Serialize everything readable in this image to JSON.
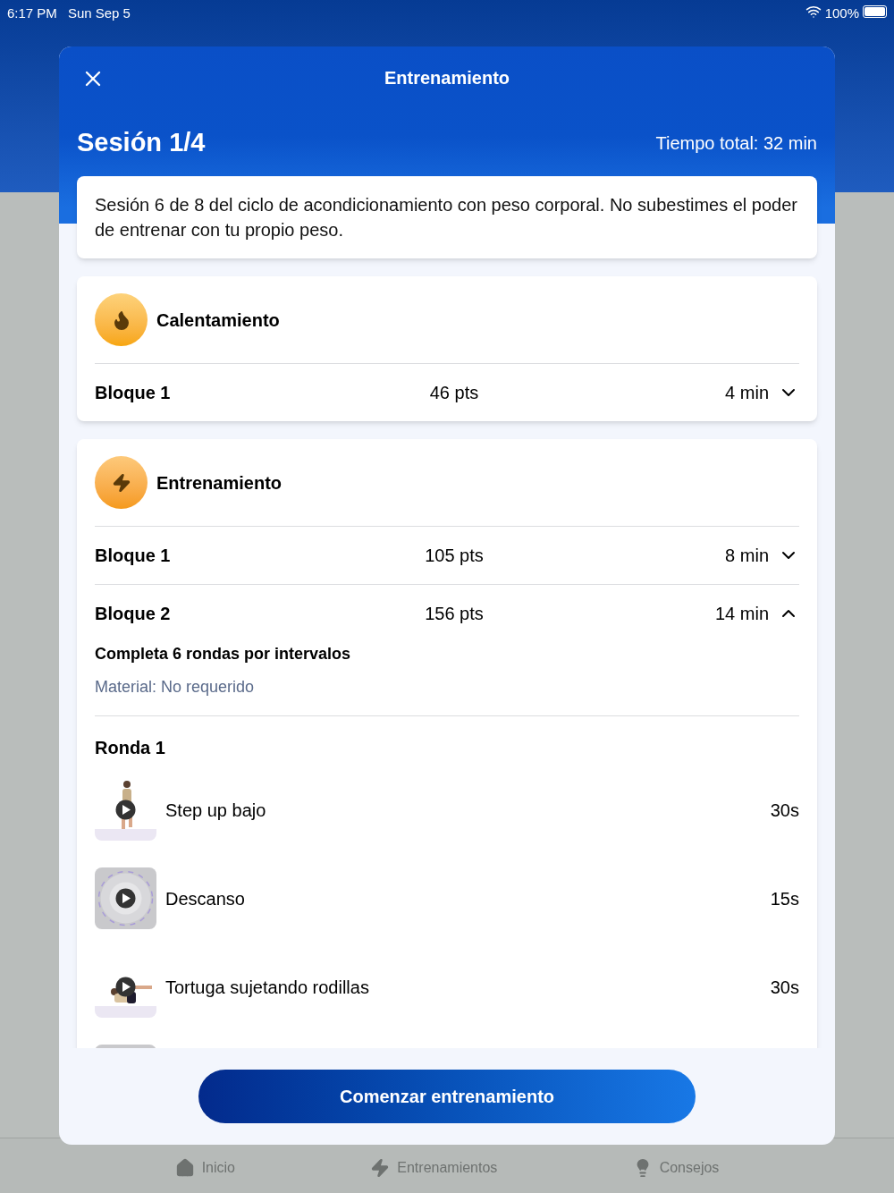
{
  "status_bar": {
    "time": "6:17 PM",
    "date": "Sun Sep 5",
    "battery": "100%"
  },
  "modal": {
    "title": "Entrenamiento",
    "session": "Sesión 1/4",
    "total_time": "Tiempo total: 32 min",
    "description": "Sesión 6 de 8 del ciclo de acondicionamiento con peso corporal. No subestimes el poder de entrenar con tu propio peso.",
    "sections": [
      {
        "title": "Calentamiento",
        "blocks": [
          {
            "name": "Bloque 1",
            "points": "46 pts",
            "duration": "4 min",
            "expanded": false
          }
        ]
      },
      {
        "title": "Entrenamiento",
        "blocks": [
          {
            "name": "Bloque 1",
            "points": "105 pts",
            "duration": "8 min",
            "expanded": false
          },
          {
            "name": "Bloque 2",
            "points": "156 pts",
            "duration": "14 min",
            "expanded": true,
            "instructions": "Completa 6 rondas por intervalos",
            "material": "Material: No requerido",
            "rounds": [
              {
                "title": "Ronda 1",
                "exercises": [
                  {
                    "kind": "exercise",
                    "name": "Step up bajo",
                    "duration": "30s"
                  },
                  {
                    "kind": "rest",
                    "name": "Descanso",
                    "duration": "15s"
                  },
                  {
                    "kind": "exercise",
                    "name": "Tortuga sujetando rodillas",
                    "duration": "30s"
                  },
                  {
                    "kind": "rest"
                  }
                ]
              }
            ]
          }
        ]
      }
    ],
    "start_button": "Comenzar entrenamiento"
  },
  "tab_bar": [
    {
      "label": "Inicio"
    },
    {
      "label": "Entrenamientos"
    },
    {
      "label": "Consejos"
    }
  ]
}
